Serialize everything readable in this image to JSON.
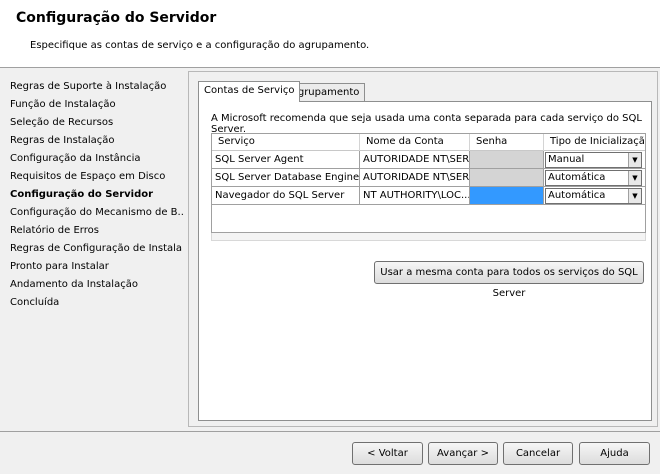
{
  "header": {
    "title": "Configuração do Servidor",
    "subtitle": "Especifique as contas de serviço e a configuração do agrupamento."
  },
  "sidebar": {
    "items": [
      {
        "label": "Regras de Suporte à Instalação",
        "active": false
      },
      {
        "label": "Função de Instalação",
        "active": false
      },
      {
        "label": "Seleção de Recursos",
        "active": false
      },
      {
        "label": "Regras de Instalação",
        "active": false
      },
      {
        "label": "Configuração da Instância",
        "active": false
      },
      {
        "label": "Requisitos de Espaço em Disco",
        "active": false
      },
      {
        "label": "Configuração do Servidor",
        "active": true
      },
      {
        "label": "Configuração do Mecanismo de B...",
        "active": false
      },
      {
        "label": "Relatório de Erros",
        "active": false
      },
      {
        "label": "Regras de Configuração de Instala...",
        "active": false
      },
      {
        "label": "Pronto para Instalar",
        "active": false
      },
      {
        "label": "Andamento da Instalação",
        "active": false
      },
      {
        "label": "Concluída",
        "active": false
      }
    ]
  },
  "tabs": [
    {
      "label": "Contas de Serviço",
      "active": true
    },
    {
      "label": "Agrupamento",
      "active": false
    }
  ],
  "panel": {
    "info": "A Microsoft recomenda que seja usada uma conta separada para cada serviço do SQL Server."
  },
  "grid": {
    "headers": {
      "service": "Serviço",
      "account": "Nome da Conta",
      "password": "Senha",
      "startup": "Tipo de Inicialização"
    },
    "rows": [
      {
        "service": "SQL Server Agent",
        "account": "AUTORIDADE NT\\SER...",
        "password": "",
        "startup": "Manual"
      },
      {
        "service": "SQL Server Database Engine",
        "account": "AUTORIDADE NT\\SER...",
        "password": "",
        "startup": "Automática"
      },
      {
        "service": "Navegador do SQL Server",
        "account": "NT AUTHORITY\\LOC...",
        "password": "",
        "startup": "Automática"
      }
    ]
  },
  "same_account_button": "Usar a mesma conta para todos os serviços do SQL Server",
  "footer": {
    "back": "< Voltar",
    "next": "Avançar >",
    "cancel": "Cancelar",
    "help": "Ajuda"
  },
  "colors": {
    "selection": "#3399ff",
    "disabled_cell": "#d4d4d4"
  },
  "icons": {
    "dropdown": "chevron-down-icon"
  }
}
